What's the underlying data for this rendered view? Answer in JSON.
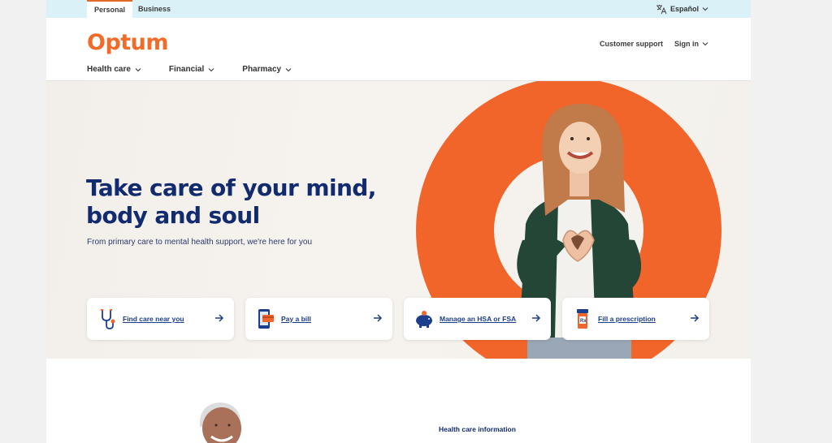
{
  "utility": {
    "tabs": [
      "Personal",
      "Business"
    ],
    "language": "Español"
  },
  "header": {
    "logo": "Optum",
    "links": [
      "Customer support",
      "Sign in"
    ],
    "nav": [
      "Health care",
      "Financial",
      "Pharmacy"
    ]
  },
  "hero": {
    "title": "Take care of your mind, body and soul",
    "subtitle": "From primary care to mental health support, we're here for you"
  },
  "actions": [
    {
      "label": "Find care near you",
      "icon": "stethoscope-icon"
    },
    {
      "label": "Pay a bill",
      "icon": "phone-card-icon"
    },
    {
      "label": "Manage an HSA or FSA",
      "icon": "piggy-bank-icon"
    },
    {
      "label": "Fill a prescription",
      "icon": "prescription-bottle-icon"
    }
  ],
  "lower": {
    "heading": "Health care information"
  },
  "colors": {
    "brand_orange": "#f26b28",
    "navy": "#122b6e",
    "utility_bar": "#d9f1f7"
  }
}
